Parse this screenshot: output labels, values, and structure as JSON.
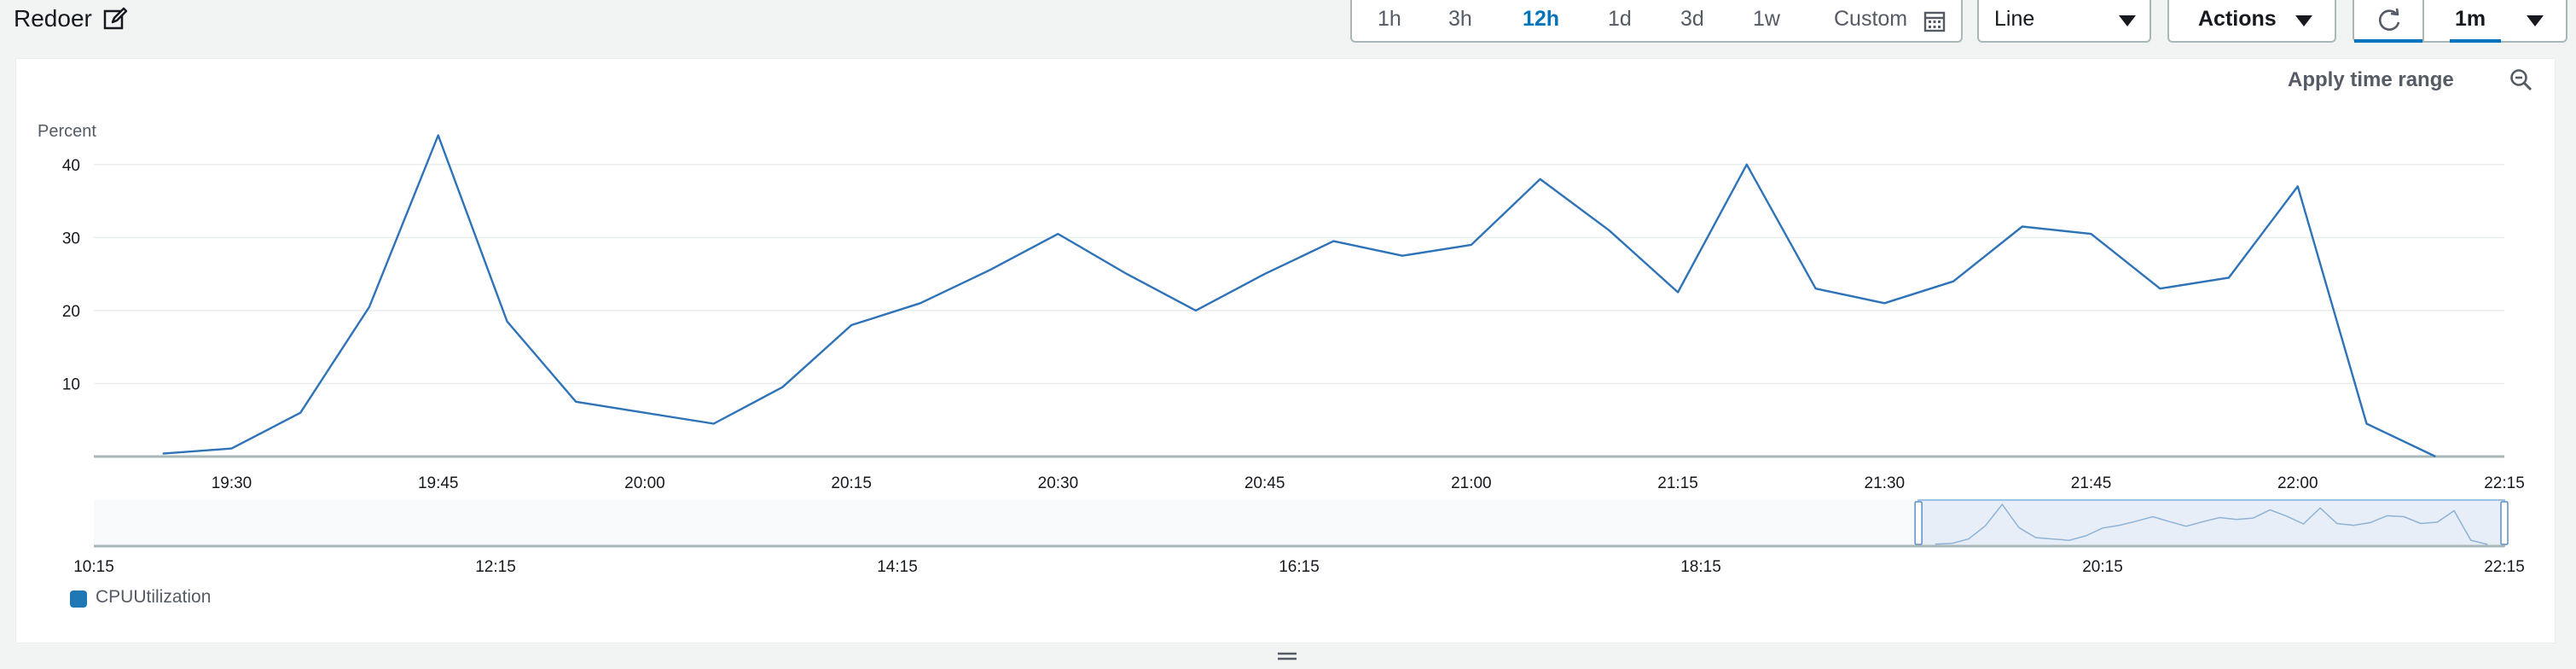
{
  "header": {
    "title": "Redoer",
    "edit_icon": "edit-icon"
  },
  "time_range": {
    "options": [
      "1h",
      "3h",
      "12h",
      "1d",
      "3d",
      "1w"
    ],
    "active": "12h",
    "custom_label": "Custom",
    "calendar_icon": "calendar-icon"
  },
  "view_select": {
    "value": "Line"
  },
  "actions": {
    "label": "Actions"
  },
  "refresh": {
    "icon": "refresh-icon"
  },
  "interval": {
    "value": "1m"
  },
  "panel": {
    "apply_time_range": "Apply time range",
    "zoom_icon": "zoom-out-icon",
    "legend_label": "CPUUtilization"
  },
  "colors": {
    "series": "#2e73b8",
    "active": "#0073bb",
    "brush": "#dfeaf6"
  },
  "chart_data": {
    "type": "line",
    "ylabel": "Percent",
    "yticks": [
      10,
      20,
      30,
      40
    ],
    "ylim": [
      0,
      45
    ],
    "xticks": [
      "19:30",
      "19:45",
      "20:00",
      "20:15",
      "20:30",
      "20:45",
      "21:00",
      "21:15",
      "21:30",
      "21:45",
      "22:00",
      "22:15"
    ],
    "x_range": [
      "19:20",
      "22:15"
    ],
    "grid": true,
    "legend": "bottom-left",
    "series": [
      {
        "name": "CPUUtilization",
        "x": [
          "19:25",
          "19:30",
          "19:35",
          "19:40",
          "19:45",
          "19:50",
          "19:55",
          "20:00",
          "20:05",
          "20:10",
          "20:15",
          "20:20",
          "20:25",
          "20:30",
          "20:35",
          "20:40",
          "20:45",
          "20:50",
          "20:55",
          "21:00",
          "21:05",
          "21:10",
          "21:15",
          "21:20",
          "21:25",
          "21:30",
          "21:35",
          "21:40",
          "21:45",
          "21:50",
          "21:55",
          "22:00",
          "22:05",
          "22:10"
        ],
        "values": [
          0.4,
          1.1,
          6,
          20.5,
          44,
          18.5,
          7.5,
          6,
          4.5,
          9.5,
          18,
          21,
          25.5,
          30.5,
          25,
          20,
          25,
          29.5,
          27.5,
          29,
          38,
          31,
          22.5,
          40,
          23,
          21,
          24,
          31.5,
          30.5,
          23,
          24.5,
          37,
          4.5,
          0
        ]
      }
    ],
    "overview": {
      "xticks": [
        "10:15",
        "12:15",
        "14:15",
        "16:15",
        "18:15",
        "20:15",
        "22:15"
      ],
      "x_range": [
        "10:15",
        "22:15"
      ],
      "selection": [
        "19:20",
        "22:15"
      ]
    }
  }
}
